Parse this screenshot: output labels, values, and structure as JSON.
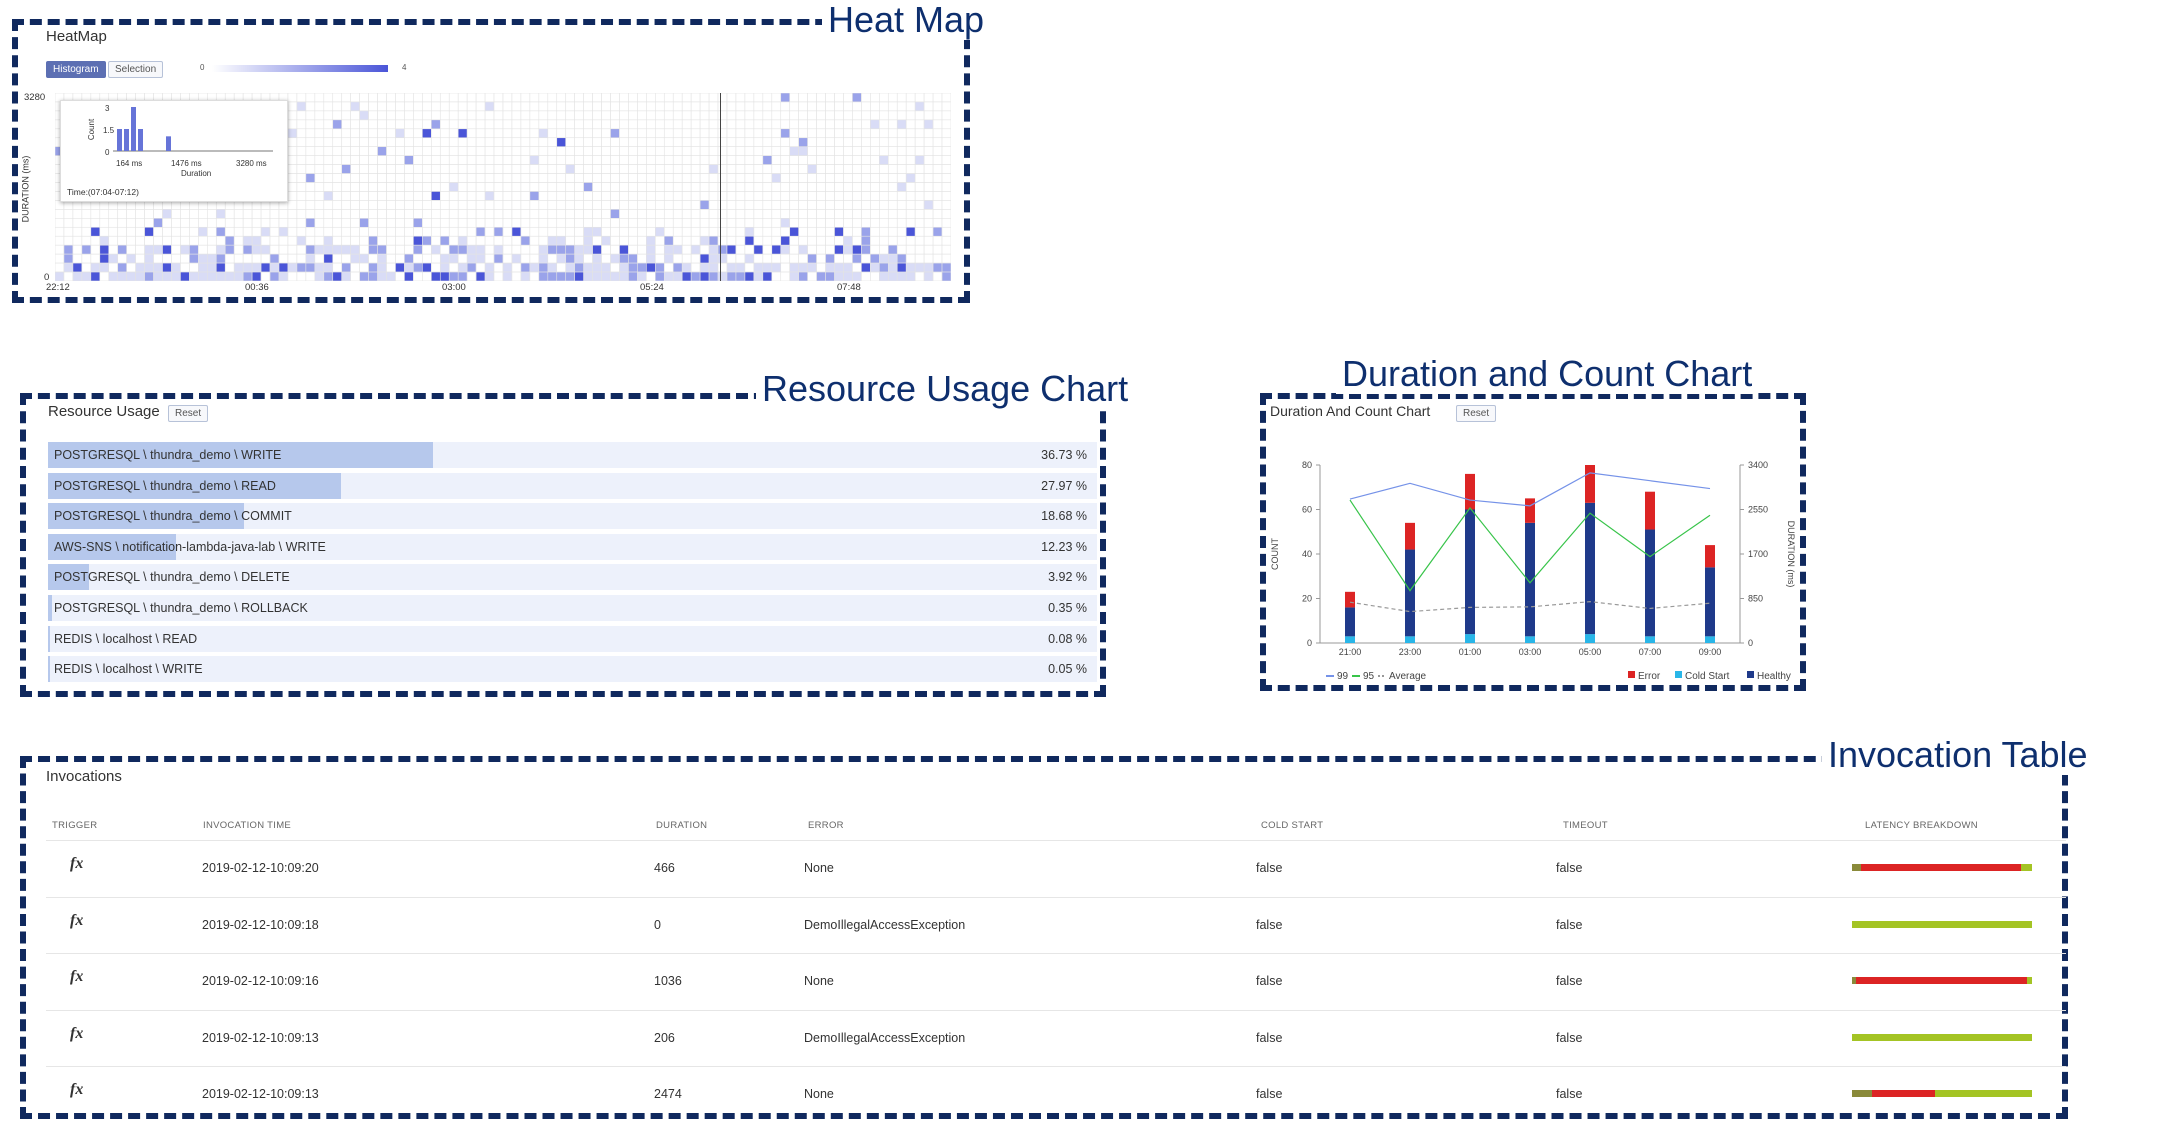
{
  "callouts": {
    "heatmap": "Heat Map",
    "resource": "Resource Usage Chart",
    "duration": "Duration and Count Chart",
    "invocation": "Invocation Table"
  },
  "heatmap": {
    "title": "HeatMap",
    "tabs": [
      "Histogram",
      "Selection"
    ],
    "scale_min": "0",
    "scale_max": "4",
    "y_label": "DURATION (ms)",
    "y_max": "3280",
    "y_min": "0",
    "x_ticks": [
      "22:12",
      "00:36",
      "03:00",
      "05:24",
      "07:48"
    ],
    "tooltip": {
      "y_label": "Count",
      "y_ticks": [
        "3",
        "1.5",
        "0"
      ],
      "x_ticks": [
        "164 ms",
        "1476 ms",
        "3280 ms"
      ],
      "x_label": "Duration",
      "time": "Time:(07:04-07:12)",
      "bars": [
        1.5,
        1.5,
        3.0,
        1.5,
        0,
        0,
        0,
        1.0
      ]
    },
    "colors": {
      "low": "#d9dcf6",
      "mid": "#9aa3ea",
      "high": "#4a55d8",
      "grid": "#e3e3e3"
    }
  },
  "resource": {
    "title": "Resource Usage",
    "reset": "Reset",
    "rows": [
      {
        "label": "POSTGRESQL \\ thundra_demo \\ WRITE",
        "pct": "36.73 %",
        "value": 36.73
      },
      {
        "label": "POSTGRESQL \\ thundra_demo \\ READ",
        "pct": "27.97 %",
        "value": 27.97
      },
      {
        "label": "POSTGRESQL \\ thundra_demo \\ COMMIT",
        "pct": "18.68 %",
        "value": 18.68
      },
      {
        "label": "AWS-SNS \\ notification-lambda-java-lab \\ WRITE",
        "pct": "12.23 %",
        "value": 12.23
      },
      {
        "label": "POSTGRESQL \\ thundra_demo \\ DELETE",
        "pct": "3.92 %",
        "value": 3.92
      },
      {
        "label": "POSTGRESQL \\ thundra_demo \\ ROLLBACK",
        "pct": "0.35 %",
        "value": 0.35
      },
      {
        "label": "REDIS \\ localhost \\ READ",
        "pct": "0.08 %",
        "value": 0.08
      },
      {
        "label": "REDIS \\ localhost \\ WRITE",
        "pct": "0.05 %",
        "value": 0.05
      }
    ]
  },
  "chart_data": {
    "type": "bar",
    "title": "Duration And Count Chart",
    "reset": "Reset",
    "ylabel": "COUNT",
    "y2label": "DURATION (ms)",
    "ylim": [
      0,
      80
    ],
    "y2lim": [
      0,
      3400
    ],
    "y_ticks": [
      "0",
      "20",
      "40",
      "60",
      "80"
    ],
    "y2_ticks": [
      "0",
      "850",
      "1700",
      "2550",
      "3400"
    ],
    "categories": [
      "21:00",
      "23:00",
      "01:00",
      "03:00",
      "05:00",
      "07:00",
      "09:00"
    ],
    "stacked_series": [
      {
        "name": "Cold Start",
        "color": "#29b6e8",
        "values": [
          3,
          3,
          4,
          3,
          4,
          3,
          3
        ]
      },
      {
        "name": "Healthy",
        "color": "#1f3a8a",
        "values": [
          13,
          39,
          56,
          51,
          59,
          48,
          31
        ]
      },
      {
        "name": "Error",
        "color": "#dc2424",
        "values": [
          7,
          12,
          16,
          11,
          17,
          17,
          10
        ]
      }
    ],
    "line_series": [
      {
        "name": "99",
        "color": "#7592e8",
        "values": [
          2750,
          3050,
          2730,
          2620,
          3250,
          3100,
          2950
        ]
      },
      {
        "name": "95",
        "color": "#38c44a",
        "values": [
          2730,
          1000,
          2580,
          1150,
          2480,
          1650,
          2440
        ]
      },
      {
        "name": "Average",
        "color": "#999999",
        "values": [
          780,
          600,
          680,
          690,
          790,
          660,
          760
        ]
      }
    ],
    "legend_left": [
      "99",
      "95",
      "Average"
    ],
    "legend_right": [
      "Error",
      "Cold Start",
      "Healthy"
    ]
  },
  "invocations": {
    "title": "Invocations",
    "headers": [
      "TRIGGER",
      "INVOCATION TIME",
      "DURATION",
      "ERROR",
      "COLD START",
      "TIMEOUT",
      "LATENCY BREAKDOWN"
    ],
    "rows": [
      {
        "trigger": "fx",
        "time": "2019-02-12-10:09:20",
        "duration": "466",
        "error": "None",
        "cold": "false",
        "timeout": "false",
        "latency": [
          [
            "#8a8a3a",
            5
          ],
          [
            "#dc2424",
            89
          ],
          [
            "#a4c424",
            6
          ]
        ]
      },
      {
        "trigger": "fx",
        "time": "2019-02-12-10:09:18",
        "duration": "0",
        "error": "DemoIllegalAccessException",
        "cold": "false",
        "timeout": "false",
        "latency": [
          [
            "#a4c424",
            100
          ]
        ]
      },
      {
        "trigger": "fx",
        "time": "2019-02-12-10:09:16",
        "duration": "1036",
        "error": "None",
        "cold": "false",
        "timeout": "false",
        "latency": [
          [
            "#8a8a3a",
            2
          ],
          [
            "#dc2424",
            95
          ],
          [
            "#a4c424",
            3
          ]
        ]
      },
      {
        "trigger": "fx",
        "time": "2019-02-12-10:09:13",
        "duration": "206",
        "error": "DemoIllegalAccessException",
        "cold": "false",
        "timeout": "false",
        "latency": [
          [
            "#a4c424",
            100
          ]
        ]
      },
      {
        "trigger": "fx",
        "time": "2019-02-12-10:09:13",
        "duration": "2474",
        "error": "None",
        "cold": "false",
        "timeout": "false",
        "latency": [
          [
            "#8a8a3a",
            11
          ],
          [
            "#dc2424",
            35
          ],
          [
            "#a4c424",
            54
          ]
        ]
      }
    ]
  }
}
